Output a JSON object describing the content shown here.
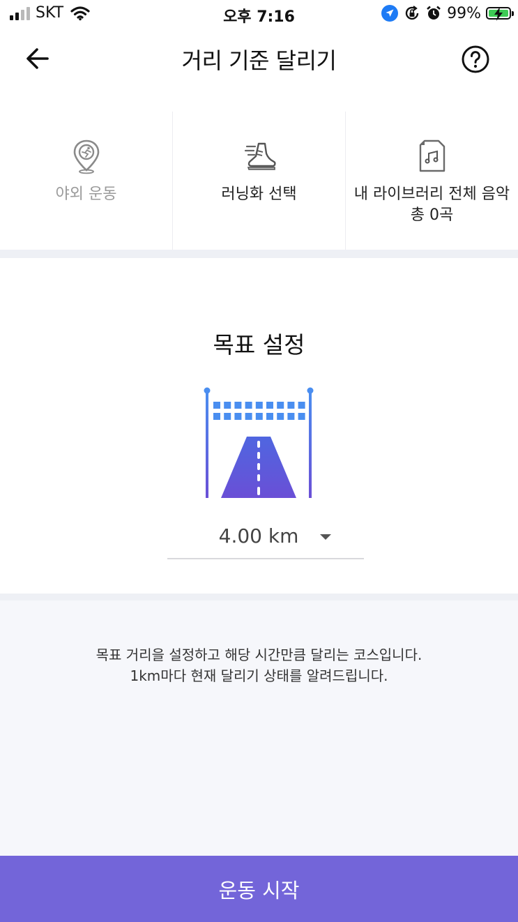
{
  "status_bar": {
    "carrier": "SKT",
    "time": "오후 7:16",
    "battery_percent": "99%",
    "battery_level": 0.99,
    "icons": [
      "signal-icon",
      "wifi-icon",
      "location-icon",
      "rotation-lock-icon",
      "alarm-icon",
      "battery-charging-icon"
    ]
  },
  "nav": {
    "title": "거리 기준 달리기",
    "back_icon": "arrow-left-icon",
    "help_icon": "question-circle-icon"
  },
  "options": {
    "outdoor": {
      "label": "야외 운동",
      "icon": "map-pin-runner-icon"
    },
    "shoes": {
      "label": "러닝화 선택",
      "icon": "running-shoe-icon"
    },
    "music": {
      "line1": "내 라이브러리 전체 음악",
      "line2": "총 0곡",
      "icon": "music-file-icon"
    }
  },
  "goal": {
    "title": "목표 설정",
    "illustration": "finish-line-road-icon",
    "distance": "4.00 km",
    "dropdown_icon": "caret-down-icon"
  },
  "description": {
    "line1": "목표 거리을 설정하고 해당 시간만큼 달리는 코스입니다.",
    "line2": "1km마다 현재 달리기 상태를 알려드립니다."
  },
  "start_button": {
    "label": "운동 시작"
  },
  "colors": {
    "accent": "#7365d9",
    "illustration_blue": "#4a8ef0",
    "illustration_purple": "#6a4fd6",
    "section_bg": "#f6f7fb"
  }
}
